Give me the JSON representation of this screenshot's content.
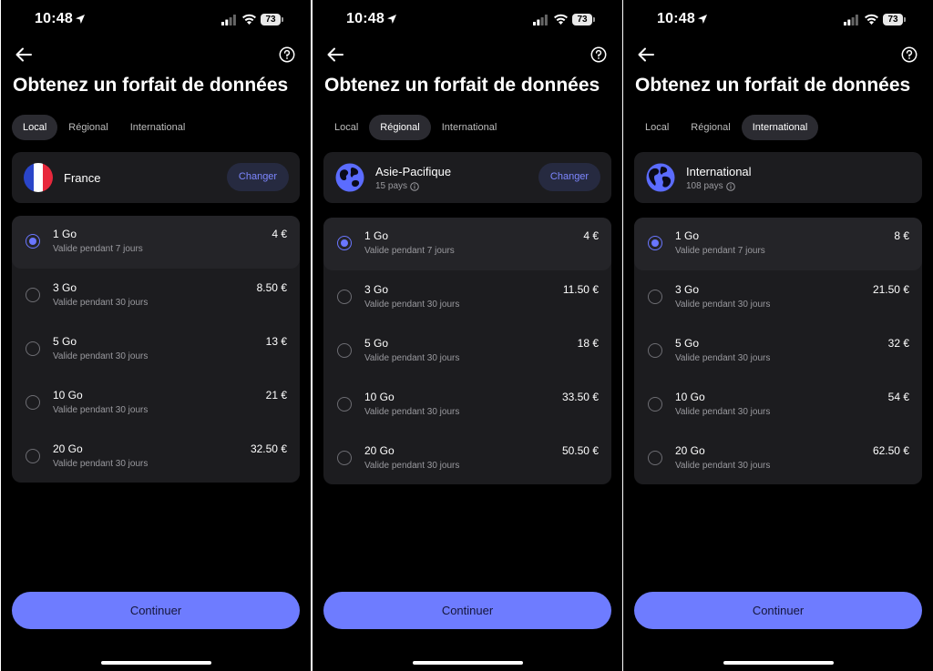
{
  "status": {
    "time": "10:48",
    "battery": "73"
  },
  "colors": {
    "background": "#000000",
    "card": "#1c1c1f",
    "accent": "#6e7cff",
    "tab_active": "#2b2b31"
  },
  "icons": {
    "back": "arrow-left-icon",
    "help": "question-circle-icon",
    "france": "france-flag-icon",
    "globe": "globe-icon",
    "info": "info-icon"
  },
  "title": "Obtenez un forfait de données",
  "tabs": [
    "Local",
    "Régional",
    "International"
  ],
  "continue_label": "Continuer",
  "screens": [
    {
      "active_tab": "Local",
      "region": {
        "name": "France",
        "sub": "",
        "change_label": "Changer"
      },
      "plans": [
        {
          "size": "1 Go",
          "validity": "Valide pendant 7 jours",
          "price": "4 €",
          "selected": true
        },
        {
          "size": "3 Go",
          "validity": "Valide pendant 30 jours",
          "price": "8.50 €",
          "selected": false
        },
        {
          "size": "5 Go",
          "validity": "Valide pendant 30 jours",
          "price": "13 €",
          "selected": false
        },
        {
          "size": "10 Go",
          "validity": "Valide pendant 30 jours",
          "price": "21 €",
          "selected": false
        },
        {
          "size": "20 Go",
          "validity": "Valide pendant 30 jours",
          "price": "32.50 €",
          "selected": false
        }
      ]
    },
    {
      "active_tab": "Régional",
      "region": {
        "name": "Asie-Pacifique",
        "sub": "15 pays",
        "change_label": "Changer"
      },
      "plans": [
        {
          "size": "1 Go",
          "validity": "Valide pendant 7 jours",
          "price": "4 €",
          "selected": true
        },
        {
          "size": "3 Go",
          "validity": "Valide pendant 30 jours",
          "price": "11.50 €",
          "selected": false
        },
        {
          "size": "5 Go",
          "validity": "Valide pendant 30 jours",
          "price": "18 €",
          "selected": false
        },
        {
          "size": "10 Go",
          "validity": "Valide pendant 30 jours",
          "price": "33.50 €",
          "selected": false
        },
        {
          "size": "20 Go",
          "validity": "Valide pendant 30 jours",
          "price": "50.50 €",
          "selected": false
        }
      ]
    },
    {
      "active_tab": "International",
      "region": {
        "name": "International",
        "sub": "108 pays",
        "change_label": ""
      },
      "plans": [
        {
          "size": "1 Go",
          "validity": "Valide pendant 7 jours",
          "price": "8 €",
          "selected": true
        },
        {
          "size": "3 Go",
          "validity": "Valide pendant 30 jours",
          "price": "21.50 €",
          "selected": false
        },
        {
          "size": "5 Go",
          "validity": "Valide pendant 30 jours",
          "price": "32 €",
          "selected": false
        },
        {
          "size": "10 Go",
          "validity": "Valide pendant 30 jours",
          "price": "54 €",
          "selected": false
        },
        {
          "size": "20 Go",
          "validity": "Valide pendant 30 jours",
          "price": "62.50 €",
          "selected": false
        }
      ]
    }
  ]
}
